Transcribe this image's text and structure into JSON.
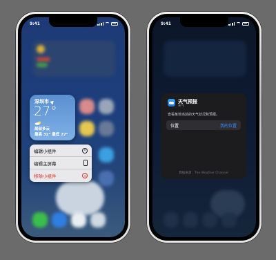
{
  "left_phone": {
    "status": {
      "time": "9:41"
    },
    "weather_widget": {
      "city": "深圳市",
      "temperature": "27°",
      "condition": "局部多云",
      "range": "最高 32° 最低 27°",
      "icon": "location-arrow-icon"
    },
    "context_menu": {
      "items": [
        {
          "label": "编辑小组件",
          "icon": "info-icon"
        },
        {
          "label": "编辑主屏幕",
          "icon": "phone-icon"
        },
        {
          "label": "移除小组件",
          "icon": "minus-circle-icon"
        }
      ]
    }
  },
  "right_phone": {
    "status": {
      "time": "9:41"
    },
    "widget_config": {
      "title": "天气预报",
      "subtitle": "天气",
      "description": "查看某地当前的天气状况和预报。",
      "location_label": "位置",
      "location_value": "我的位置",
      "source": "数据来源：The Weather Channel"
    }
  },
  "colors": {
    "background": "#6b6b6b",
    "accent_blue": "#3a8bff",
    "destructive_red": "#e0322a",
    "widget_blue": "#5a8fd1"
  }
}
